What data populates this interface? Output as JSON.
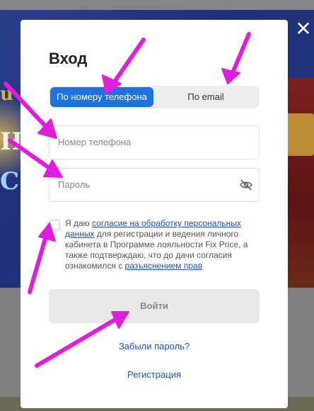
{
  "modal": {
    "title": "Вход",
    "tabs": [
      {
        "label": "По номеру телефона",
        "active": true
      },
      {
        "label": "По email",
        "active": false
      }
    ],
    "phone_placeholder": "Номер телефона",
    "password_placeholder": "Пароль",
    "consent": {
      "prefix": "Я даю ",
      "link1": "согласие на обработку персональных данных",
      "middle": " для регистрации и ведения личного кабинета в Программе лояльности Fix Price, а также подтверждаю, что до дачи согласия ознакомился с ",
      "link2": "разъяснением прав"
    },
    "login_button": "Войти",
    "forgot_password": "Забыли пароль?",
    "register": "Регистрация",
    "close_symbol": "✕"
  },
  "background": {
    "decor_letters": [
      "u",
      "H",
      "C"
    ]
  },
  "colors": {
    "accent": "#1a73e0",
    "link": "#1a4fd6",
    "annotation": "#e21be0"
  }
}
